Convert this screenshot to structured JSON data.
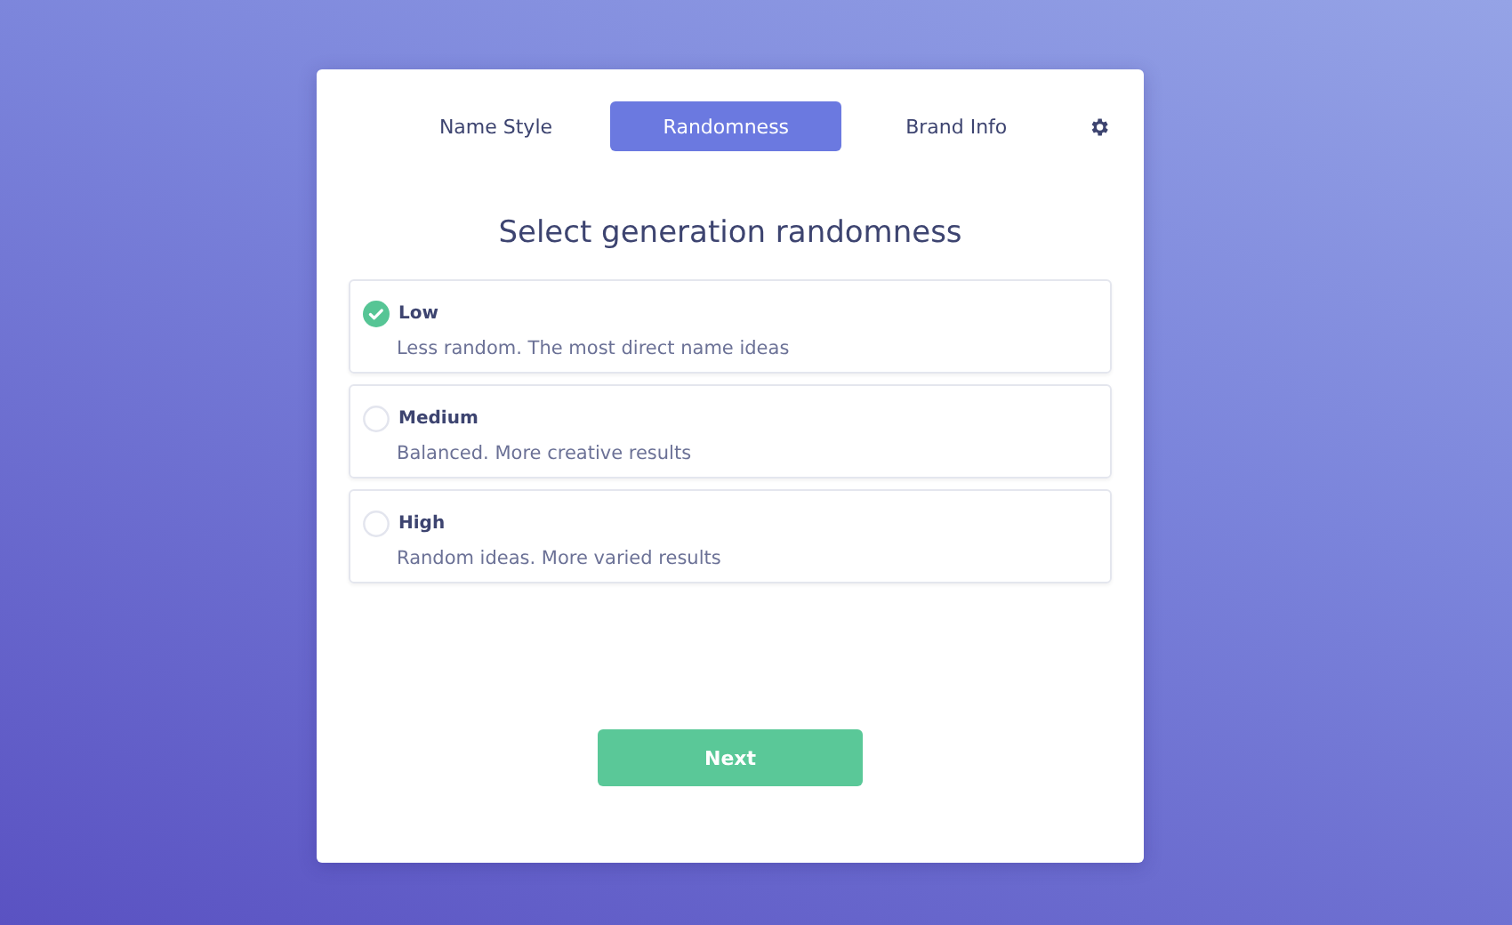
{
  "tabs": [
    {
      "label": "Name Style",
      "selected": false
    },
    {
      "label": "Randomness",
      "selected": true
    },
    {
      "label": "Brand Info",
      "selected": false
    }
  ],
  "heading": "Select generation randomness",
  "options": [
    {
      "title": "Low",
      "description": "Less random. The most direct name ideas",
      "selected": true
    },
    {
      "title": "Medium",
      "description": "Balanced. More creative results",
      "selected": false
    },
    {
      "title": "High",
      "description": "Random ideas. More varied results",
      "selected": false
    }
  ],
  "next_button": "Next"
}
